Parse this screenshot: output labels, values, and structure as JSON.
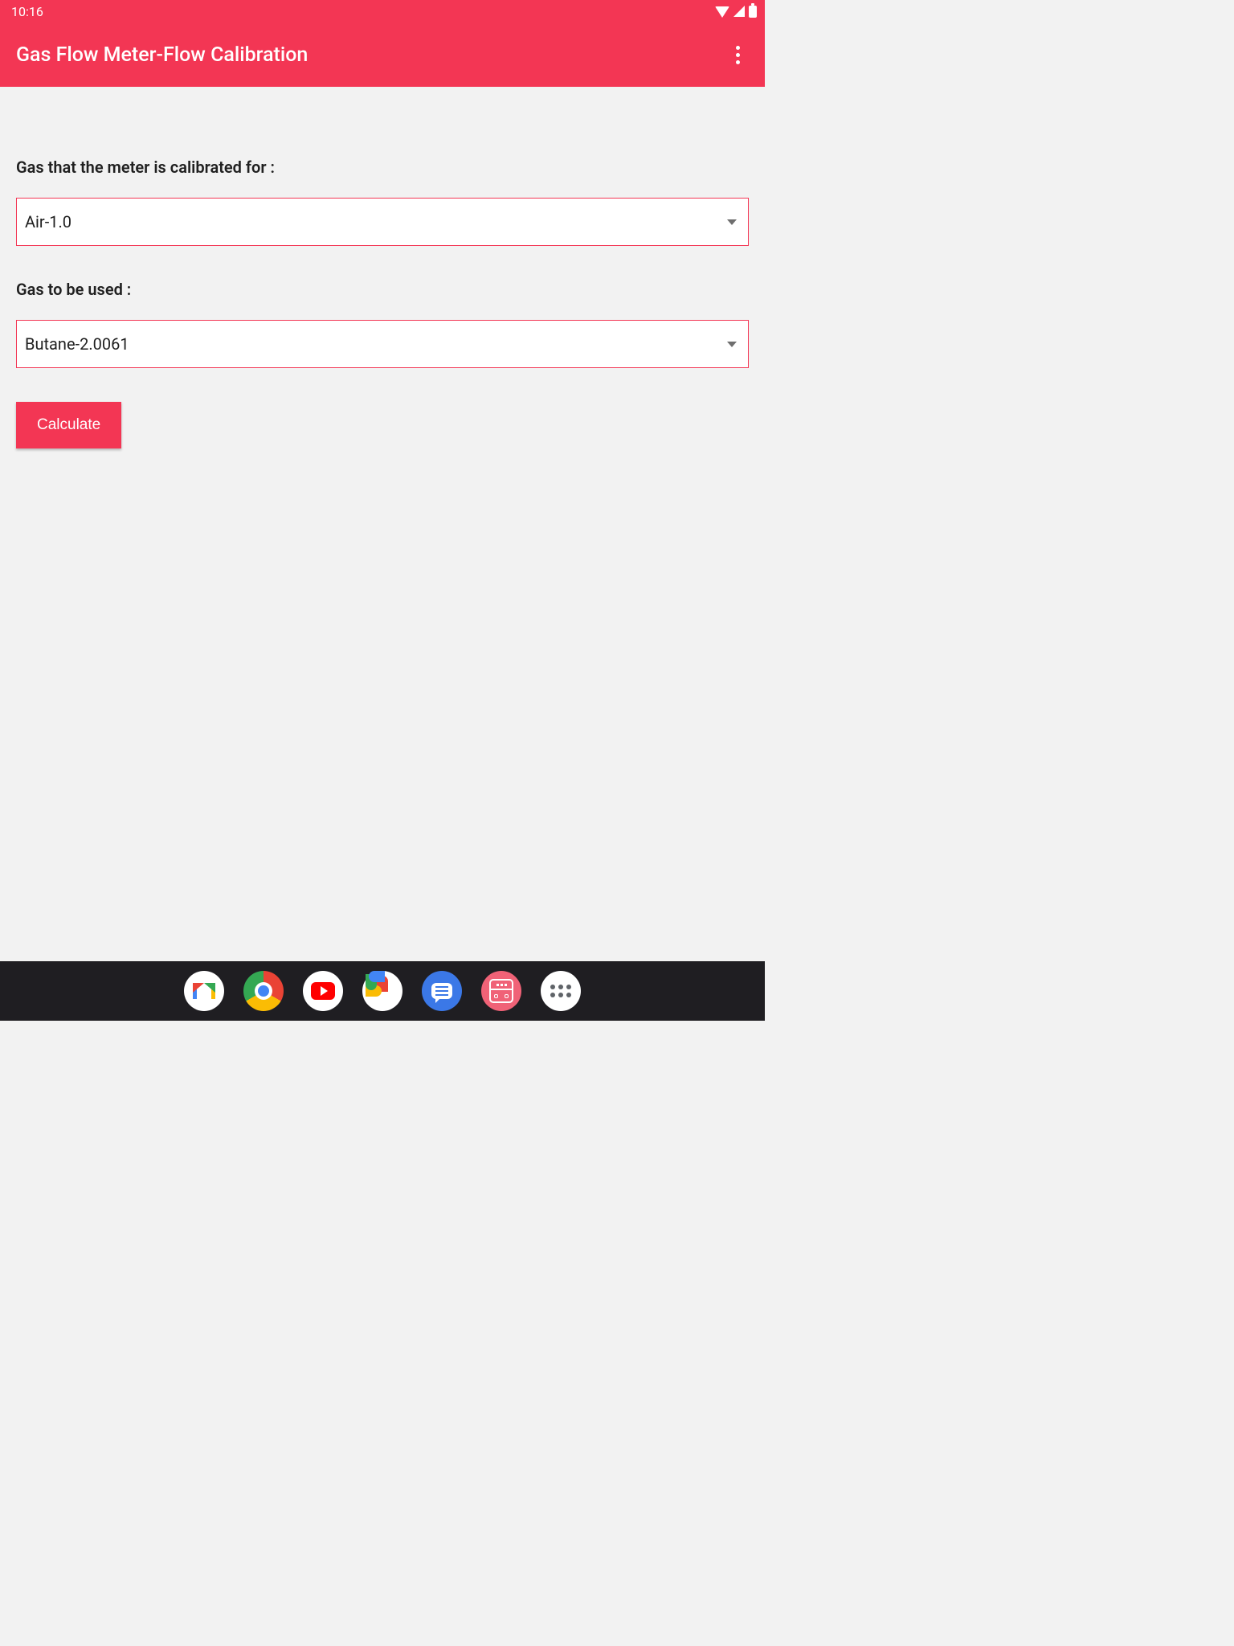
{
  "statusbar": {
    "time": "10:16"
  },
  "appbar": {
    "title": "Gas Flow Meter-Flow Calibration"
  },
  "form": {
    "calibrated_label": "Gas that the meter is calibrated for :",
    "calibrated_value": "Air-1.0",
    "used_label": "Gas to be used :",
    "used_value": "Butane-2.0061",
    "calculate_label": "Calculate"
  },
  "dock": {
    "gmail": "Gmail",
    "chrome": "Chrome",
    "youtube": "YouTube",
    "photos": "Photos",
    "messages": "Messages",
    "calcapp": "Gas Flow Meter",
    "allapps": "All apps"
  }
}
